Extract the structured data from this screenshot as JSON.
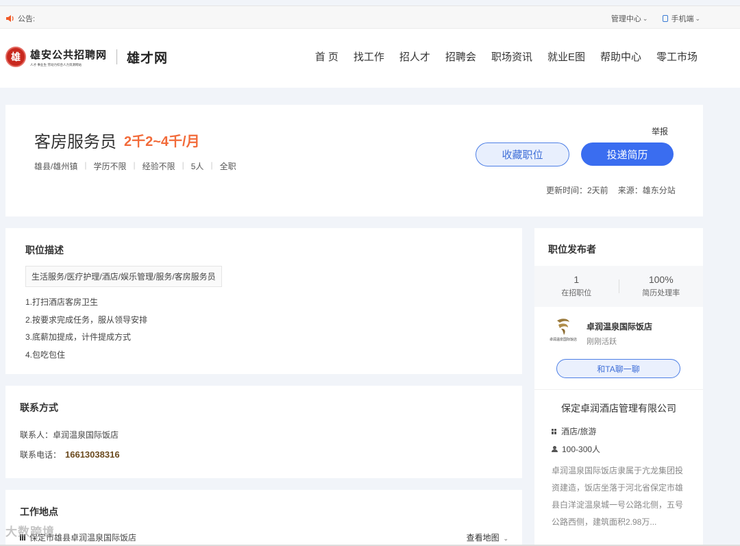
{
  "notice": {
    "label": "公告:",
    "manage_center": "管理中心",
    "mobile": "手机端"
  },
  "logo": {
    "main": "雄安公共招聘网",
    "sub": "人才·事业生·劳动力综合人力资源网站",
    "seal": "雄",
    "partner": "雄才网"
  },
  "nav": {
    "items": [
      "首 页",
      "找工作",
      "招人才",
      "招聘会",
      "职场资讯",
      "就业E图",
      "帮助中心",
      "零工市场"
    ]
  },
  "job": {
    "title": "客房服务员",
    "salary": "2千2~4千/月",
    "location": "雄县/雄州镇",
    "education": "学历不限",
    "experience": "经验不限",
    "headcount": "5人",
    "type": "全职",
    "report": "举报",
    "favorite_label": "收藏职位",
    "apply_label": "投递简历",
    "update_time": "更新时间：2天前",
    "source": "来源：雄东分站"
  },
  "description": {
    "title": "职位描述",
    "category": "生活服务/医疗护理/酒店/娱乐管理/服务/客房服务员",
    "lines": [
      "1.打扫酒店客房卫生",
      "2.按要求完成任务，服从领导安排",
      "3.底薪加提成，计件提成方式",
      "4.包吃包住"
    ]
  },
  "contact": {
    "title": "联系方式",
    "person_label": "联系人：",
    "person": "卓润温泉国际饭店",
    "phone_label": "联系电话：",
    "phone": "16613038316"
  },
  "location": {
    "title": "工作地点",
    "address": "保定市雄县卓润温泉国际饭店",
    "view_map": "查看地图"
  },
  "publisher": {
    "title": "职位发布者",
    "open_positions": "1",
    "open_positions_label": "在招职位",
    "resume_rate": "100%",
    "resume_rate_label": "简历处理率",
    "name": "卓润温泉国际饭店",
    "status": "刚刚活跃",
    "logo_text": "卓润温泉国际饭店",
    "chat_label": "和TA聊一聊",
    "company": "保定卓润酒店管理有限公司",
    "industry": "酒店/旅游",
    "size": "100-300人",
    "intro": "卓润温泉国际饭店隶属于亢龙集团投资建造，饭店坐落于河北省保定市雄县白洋淀温泉城一号公路北侧，五号公路西侧，建筑面积2.98万..."
  },
  "watermark": "大数跨境",
  "colors": {
    "accent": "#3a6df0",
    "salary": "#f26b3a",
    "brand_red": "#c8281e"
  }
}
